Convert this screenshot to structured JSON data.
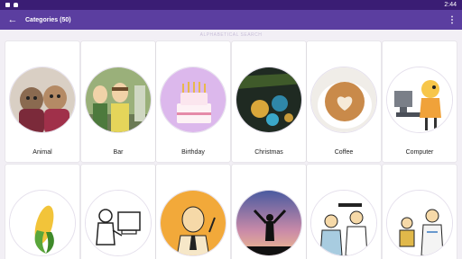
{
  "status": {
    "time": "2:44"
  },
  "appbar": {
    "title": "Categories (50)"
  },
  "subheader": "ALPHABETICAL SEARCH",
  "categories": [
    {
      "label": "Animal",
      "icon": "dogs-in-sweaters-icon"
    },
    {
      "label": "Bar",
      "icon": "bar-cartoon-icon"
    },
    {
      "label": "Birthday",
      "icon": "birthday-cake-icon"
    },
    {
      "label": "Christmas",
      "icon": "christmas-ornaments-icon"
    },
    {
      "label": "Coffee",
      "icon": "latte-art-icon"
    },
    {
      "label": "Computer",
      "icon": "computer-cartoon-icon"
    },
    {
      "label": "",
      "icon": "corn-icon"
    },
    {
      "label": "",
      "icon": "computer-user-cartoon-icon"
    },
    {
      "label": "",
      "icon": "salesman-cartoon-icon"
    },
    {
      "label": "",
      "icon": "sunset-silhouette-icon"
    },
    {
      "label": "",
      "icon": "doctors-cartoon-icon"
    },
    {
      "label": "",
      "icon": "doctor-patient-cartoon-icon"
    }
  ]
}
